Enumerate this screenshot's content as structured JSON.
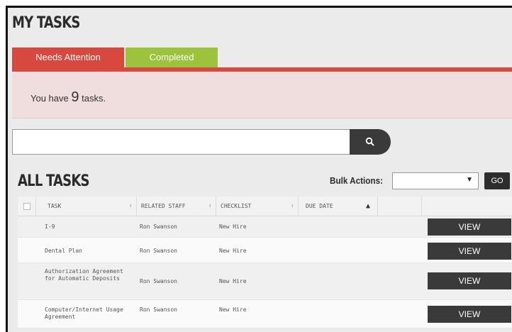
{
  "page_title": "MY TASKS",
  "tabs": [
    {
      "label": "Needs Attention",
      "active": true,
      "color": "#d9483e"
    },
    {
      "label": "Completed",
      "active": false,
      "color": "#9bc43c"
    }
  ],
  "alert": {
    "prefix": "You have",
    "count": "9",
    "suffix": "tasks."
  },
  "search": {
    "value": "",
    "placeholder": "",
    "icon": "search-icon"
  },
  "all_tasks": {
    "title": "ALL TASKS",
    "bulk_actions_label": "Bulk Actions:",
    "bulk_actions_value": "",
    "go_label": "GO"
  },
  "table": {
    "headers": [
      "TASK",
      "RELATED STAFF",
      "CHECKLIST",
      "DUE DATE"
    ],
    "rows": [
      {
        "task": "I-9",
        "staff": "Ron Swanson",
        "checklist": "New Hire",
        "due": "",
        "action": "VIEW"
      },
      {
        "task": "Dental Plan",
        "staff": "Ron Swanson",
        "checklist": "New Hire",
        "due": "",
        "action": "VIEW"
      },
      {
        "task": "Authorization Agreement for Automatic Deposits",
        "staff": "Ron Swanson",
        "checklist": "New Hire",
        "due": "",
        "action": "VIEW"
      },
      {
        "task": "Computer/Internet Usage Agreement",
        "staff": "Ron Swanson",
        "checklist": "New Hire",
        "due": "",
        "action": "VIEW"
      }
    ]
  },
  "colors": {
    "accent_red": "#d9483e",
    "accent_green": "#9bc43c",
    "alert_bg": "#f0dddd",
    "dark_button": "#3a3a3a"
  }
}
